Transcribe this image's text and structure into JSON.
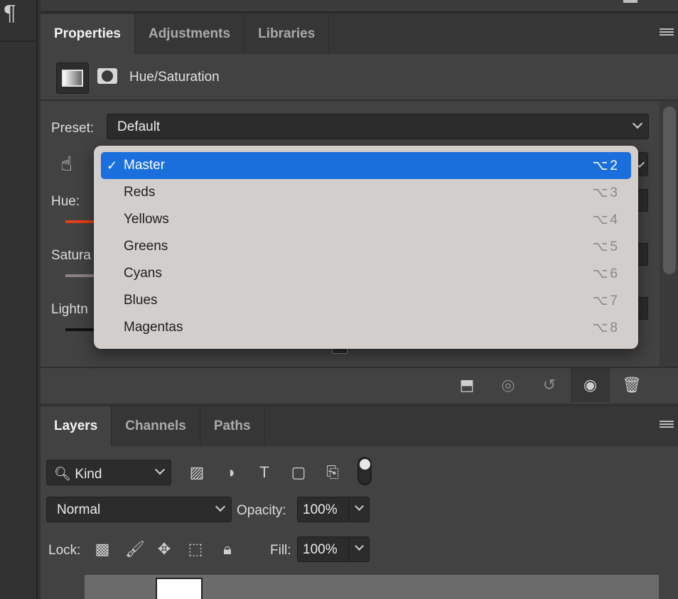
{
  "left_toolbar": {
    "paragraph_glyph": "¶"
  },
  "properties_panel": {
    "tabs": [
      "Properties",
      "Adjustments",
      "Libraries"
    ],
    "active_tab": "Properties",
    "adjustment_title": "Hue/Saturation",
    "preset": {
      "label": "Preset:",
      "value": "Default"
    },
    "labels": {
      "hue": "Hue:",
      "saturation": "Satura",
      "lightness": "Lightn"
    }
  },
  "channel_dropdown": {
    "items": [
      {
        "label": "Master",
        "shortcut": "⌥2",
        "selected": true
      },
      {
        "label": "Reds",
        "shortcut": "⌥3",
        "selected": false
      },
      {
        "label": "Yellows",
        "shortcut": "⌥4",
        "selected": false
      },
      {
        "label": "Greens",
        "shortcut": "⌥5",
        "selected": false
      },
      {
        "label": "Cyans",
        "shortcut": "⌥6",
        "selected": false
      },
      {
        "label": "Blues",
        "shortcut": "⌥7",
        "selected": false
      },
      {
        "label": "Magentas",
        "shortcut": "⌥8",
        "selected": false
      }
    ],
    "check_glyph": "✓",
    "selected_color": "#1b6fdc"
  },
  "layers_panel": {
    "tabs": [
      "Layers",
      "Channels",
      "Paths"
    ],
    "active_tab": "Layers",
    "filter": {
      "value": "Kind"
    },
    "blend_mode": "Normal",
    "opacity": {
      "label": "Opacity:",
      "value": "100%"
    },
    "lock_label": "Lock:",
    "fill": {
      "label": "Fill:",
      "value": "100%"
    }
  },
  "colors": {
    "panel_bg": "#424242",
    "tab_bar_bg": "#363636",
    "accent_blue": "#1b6fdc",
    "hue_slider": "#e0401a"
  }
}
